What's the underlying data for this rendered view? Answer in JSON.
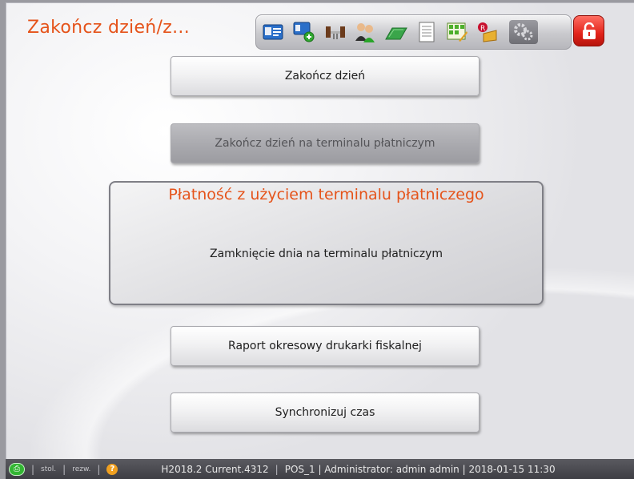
{
  "window": {
    "title": "Zakończ dzień/z..."
  },
  "toolbar": {
    "icons": [
      "id-card-icon",
      "add-card-icon",
      "chairs-icon",
      "users-icon",
      "money-icon",
      "document-icon",
      "calculator-icon",
      "reports-icon",
      "settings-icon",
      "lock-icon"
    ]
  },
  "buttons": {
    "end_day": "Zakończ dzień",
    "end_day_terminal": "Zakończ dzień na terminalu płatniczym",
    "fiscal_report": "Raport okresowy drukarki fiskalnej",
    "sync_time": "Synchronizuj czas"
  },
  "panel": {
    "title": "Płatność z użyciem terminalu płatniczego",
    "message": "Zamknięcie dnia na terminalu płatniczym"
  },
  "status": {
    "stol": "stol.",
    "rezw": "rezw.",
    "version": "H2018.2 Current.4312",
    "info": "POS_1 | Administrator: admin admin | 2018-01-15 11:30"
  },
  "colors": {
    "accent": "#e5531a",
    "lock": "#e2231a",
    "status_bg": "#4a4a50"
  }
}
